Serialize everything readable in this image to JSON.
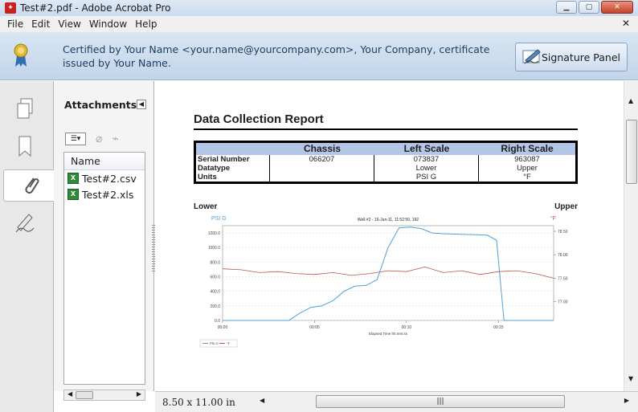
{
  "window": {
    "title": "Test#2.pdf - Adobe Acrobat Pro"
  },
  "menu": [
    "File",
    "Edit",
    "View",
    "Window",
    "Help"
  ],
  "cert_bar": {
    "message": "Certified by Your Name <your.name@yourcompany.com>, Your Company, certificate issued by Your Name.",
    "signature_button": "Signature Panel"
  },
  "attachments": {
    "header": "Attachments",
    "column": "Name",
    "items": [
      "Test#2.csv",
      "Test#2.xls"
    ]
  },
  "status": {
    "page_size": "8.50 x 11.00 in"
  },
  "report": {
    "title": "Data Collection Report",
    "columns": [
      "",
      "Chassis",
      "Left Scale",
      "Right Scale"
    ],
    "rows": [
      [
        "Serial Number",
        "066207",
        "073837",
        "963087"
      ],
      [
        "Datatype",
        "",
        "Lower",
        "Upper"
      ],
      [
        "Units",
        "",
        "PSI G",
        "°F"
      ]
    ],
    "left_label": "Lower",
    "right_label": "Upper"
  },
  "chart_data": {
    "type": "line",
    "title": "Well #2 - 16-Jun-11, 11:52:50, 192",
    "xlabel": "Elapsed Time hh:mm:ss",
    "left_unit": "PSI G",
    "right_unit": "°F",
    "x_ticks": [
      "00:00",
      "00:05",
      "00:10",
      "00:15"
    ],
    "xlim": [
      0,
      18
    ],
    "y_left_ticks": [
      "0.0",
      "200.0",
      "400.0",
      "600.0",
      "800.0",
      "1000.0",
      "1200.0"
    ],
    "ylim_left": [
      0,
      1300
    ],
    "y_right_ticks": [
      "77.00",
      "77.50",
      "78.00",
      "78.50"
    ],
    "ylim_right": [
      76.6,
      78.62
    ],
    "legend": [
      "PSI G",
      "°F"
    ],
    "colors": {
      "psi": "#4f9fd8",
      "degf": "#c0504d"
    },
    "series": [
      {
        "name": "PSI G",
        "axis": "left",
        "x": [
          0,
          3.6,
          4.2,
          4.8,
          5.4,
          6.0,
          6.6,
          7.2,
          7.8,
          8.4,
          9.0,
          9.6,
          10.2,
          10.8,
          11.4,
          12.0,
          13.2,
          14.4,
          14.9,
          15.3,
          16.5,
          18
        ],
        "y": [
          0,
          0,
          100,
          180,
          200,
          270,
          400,
          470,
          480,
          560,
          1000,
          1270,
          1280,
          1260,
          1200,
          1190,
          1180,
          1170,
          1100,
          0,
          0,
          0
        ]
      },
      {
        "name": "°F",
        "axis": "right",
        "x": [
          0,
          1,
          2,
          3,
          4,
          5,
          6,
          7,
          8,
          9,
          10,
          11,
          12,
          13,
          14,
          15,
          16,
          17,
          18
        ],
        "y": [
          77.7,
          77.68,
          77.62,
          77.64,
          77.6,
          77.58,
          77.62,
          77.56,
          77.6,
          77.66,
          77.64,
          77.74,
          77.62,
          77.66,
          77.58,
          77.64,
          77.66,
          77.6,
          77.5
        ]
      }
    ]
  }
}
